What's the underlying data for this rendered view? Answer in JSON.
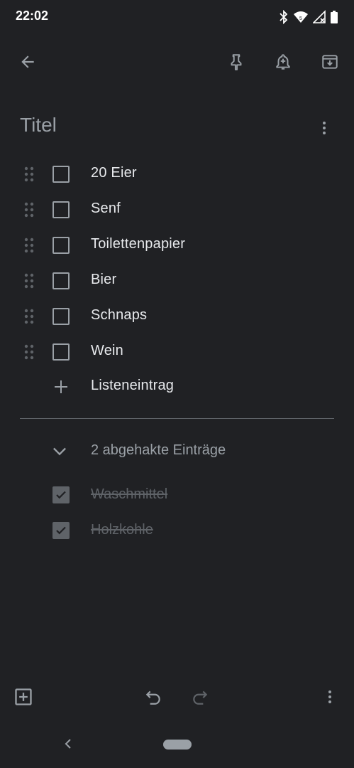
{
  "status_bar": {
    "time": "22:02",
    "icons": [
      "bluetooth-icon",
      "wifi-icon",
      "signal-icon",
      "battery-icon"
    ]
  },
  "toolbar": {
    "back": "arrow-back-icon",
    "pin": "pin-icon",
    "reminder": "bell-add-icon",
    "archive": "archive-icon"
  },
  "note": {
    "title_placeholder": "Titel",
    "items": [
      {
        "text": "20 Eier",
        "checked": false
      },
      {
        "text": "Senf",
        "checked": false
      },
      {
        "text": "Toilettenpapier",
        "checked": false
      },
      {
        "text": "Bier",
        "checked": false
      },
      {
        "text": "Schnaps",
        "checked": false
      },
      {
        "text": "Wein",
        "checked": false
      }
    ],
    "add_item_label": "Listeneintrag",
    "checked_header": "2 abgehakte Einträge",
    "checked_items": [
      {
        "text": "Waschmittel",
        "checked": true
      },
      {
        "text": "Holzkohle",
        "checked": true
      }
    ]
  },
  "bottom_bar": {
    "add": "add-box-icon",
    "undo": "undo-icon",
    "redo": "redo-icon",
    "more": "more-vert-icon"
  },
  "colors": {
    "background": "#202124",
    "text": "#e8eaed",
    "muted": "#9aa0a6",
    "disabled": "#5f6368"
  }
}
